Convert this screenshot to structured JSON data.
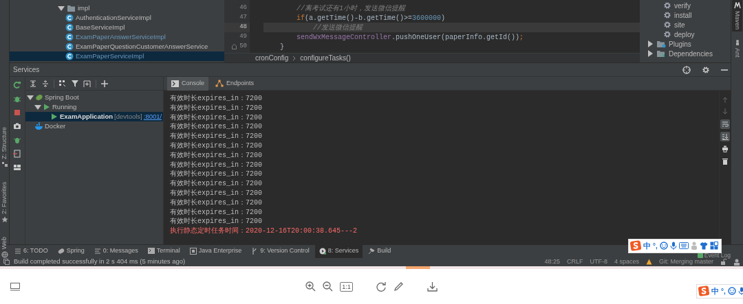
{
  "project_tree": [
    {
      "label": "impl",
      "kind": "folder",
      "expanded": true,
      "selected": false,
      "modified": false,
      "children": [
        {
          "label": "AuthenticationServiceImpl",
          "kind": "class",
          "selected": false,
          "modified": false
        },
        {
          "label": "BaseServiceImpl",
          "kind": "class",
          "selected": false,
          "modified": false
        },
        {
          "label": "ExamPaperAnswerServiceImpl",
          "kind": "class",
          "selected": false,
          "modified": true
        },
        {
          "label": "ExamPaperQuestionCustomerAnswerService",
          "kind": "class",
          "selected": false,
          "modified": false
        },
        {
          "label": "ExamPaperServiceImpl",
          "kind": "class",
          "selected": true,
          "modified": true
        }
      ]
    }
  ],
  "editor": {
    "lines": [
      {
        "number": "46",
        "current": false,
        "fold": false,
        "tokens": [
          {
            "text": "        //离考试还有1小时，发送微信提醒",
            "kind": "comment"
          }
        ]
      },
      {
        "number": "47",
        "current": false,
        "fold": false,
        "tokens": [
          {
            "text": "        if",
            "kind": "keyword"
          },
          {
            "text": "(a.getTime()-b.getTime()>=",
            "kind": "plain"
          },
          {
            "text": "3600000",
            "kind": "number"
          },
          {
            "text": ")",
            "kind": "plain"
          }
        ]
      },
      {
        "number": "48",
        "current": true,
        "fold": false,
        "tokens": [
          {
            "text": "            //发送微信提醒",
            "kind": "comment"
          }
        ]
      },
      {
        "number": "49",
        "current": false,
        "fold": false,
        "tokens": [
          {
            "text": "        sendWxMessageController",
            "kind": "field"
          },
          {
            "text": ".pushOneUser(paperInfo.getId())",
            "kind": "plain"
          },
          {
            "text": ";",
            "kind": "keyword"
          }
        ]
      },
      {
        "number": "50",
        "current": false,
        "fold": true,
        "tokens": [
          {
            "text": "    }",
            "kind": "plain"
          }
        ]
      }
    ],
    "breadcrumb": [
      "cronConfig",
      "configureTasks()"
    ]
  },
  "maven": [
    {
      "label": "verify",
      "kind": "goal"
    },
    {
      "label": "install",
      "kind": "goal"
    },
    {
      "label": "site",
      "kind": "goal"
    },
    {
      "label": "deploy",
      "kind": "goal"
    },
    {
      "label": "Plugins",
      "kind": "folder",
      "expanded": false
    },
    {
      "label": "Dependencies",
      "kind": "folder",
      "expanded": false
    }
  ],
  "right_strip": [
    {
      "label": "Maven",
      "selected": true
    },
    {
      "label": "Ant",
      "selected": false
    }
  ],
  "left_strip": [
    {
      "label": "Z: Structure"
    },
    {
      "label": "2: Favorites"
    },
    {
      "label": "Web"
    }
  ],
  "services": {
    "title": "Services",
    "tree": [
      {
        "label": "Spring Boot",
        "kind": "spring",
        "expanded": true,
        "selected": false,
        "children": [
          {
            "label": "Running",
            "kind": "running",
            "expanded": true,
            "selected": false,
            "children": [
              {
                "label": "ExamApplication",
                "tag": "[devtools]",
                "link": ":8001/",
                "kind": "app",
                "selected": true
              }
            ]
          }
        ]
      },
      {
        "label": "Docker",
        "kind": "docker",
        "selected": false
      }
    ],
    "tabs": [
      {
        "label": "Console",
        "kind": "console",
        "selected": true
      },
      {
        "label": "Endpoints",
        "kind": "endpoints",
        "selected": false
      }
    ],
    "console": [
      {
        "text": "有效时长expires_in：7200",
        "kind": "info"
      },
      {
        "text": "有效时长expires_in：7200",
        "kind": "info"
      },
      {
        "text": "有效时长expires_in：7200",
        "kind": "info"
      },
      {
        "text": "有效时长expires_in：7200",
        "kind": "info"
      },
      {
        "text": "有效时长expires_in：7200",
        "kind": "info"
      },
      {
        "text": "有效时长expires_in：7200",
        "kind": "info"
      },
      {
        "text": "有效时长expires_in：7200",
        "kind": "info"
      },
      {
        "text": "有效时长expires_in：7200",
        "kind": "info"
      },
      {
        "text": "有效时长expires_in：7200",
        "kind": "info"
      },
      {
        "text": "有效时长expires_in：7200",
        "kind": "info"
      },
      {
        "text": "有效时长expires_in：7200",
        "kind": "info"
      },
      {
        "text": "有效时长expires_in：7200",
        "kind": "info"
      },
      {
        "text": "有效时长expires_in：7200",
        "kind": "info"
      },
      {
        "text": "有效时长expires_in：7200",
        "kind": "info"
      },
      {
        "text": "执行静态定时任务时间：2020-12-16T20:00:38.645---2",
        "kind": "error"
      }
    ],
    "console_tools": [
      {
        "kind": "up",
        "on": false,
        "disabled": true
      },
      {
        "kind": "down",
        "on": false,
        "disabled": true
      },
      {
        "kind": "wrap",
        "on": true,
        "disabled": false
      },
      {
        "kind": "scroll-end",
        "on": true,
        "disabled": false
      },
      {
        "kind": "print",
        "on": false,
        "disabled": false
      },
      {
        "kind": "trash",
        "on": false,
        "disabled": false
      }
    ]
  },
  "tool_tabs": [
    {
      "label": "6: TODO",
      "kind": "todo",
      "selected": false
    },
    {
      "label": "Spring",
      "kind": "spring",
      "selected": false
    },
    {
      "label": "0: Messages",
      "kind": "messages",
      "selected": false
    },
    {
      "label": "Terminal",
      "kind": "terminal",
      "selected": false
    },
    {
      "label": "Java Enterprise",
      "kind": "java",
      "selected": false
    },
    {
      "label": "9: Version Control",
      "kind": "vcs",
      "selected": false
    },
    {
      "label": "8: Services",
      "kind": "services",
      "selected": true
    },
    {
      "label": "Build",
      "kind": "build",
      "selected": false
    }
  ],
  "status": {
    "message": "Build completed successfully in 2 s 404 ms (5 minutes ago)",
    "items": [
      "48:25",
      "CRLF",
      "UTF-8",
      "4 spaces",
      "Git: Merging master"
    ],
    "event_log": "Event Log"
  },
  "ime_bars": [
    {
      "lang": "中",
      "punct": "°,"
    },
    {
      "lang": "中",
      "punct": "°,"
    }
  ],
  "viewer": {
    "actual_size": "1:1"
  }
}
